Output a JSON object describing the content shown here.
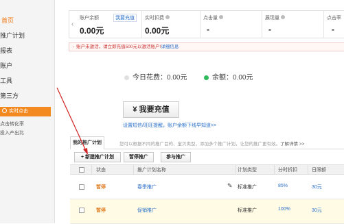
{
  "sidebar": {
    "items": [
      {
        "label": "首页",
        "active": true
      },
      {
        "label": "推广计划",
        "active": false
      },
      {
        "label": "报表",
        "active": false
      },
      {
        "label": "账户",
        "active": false
      },
      {
        "label": "工具",
        "active": false
      },
      {
        "label": "第三方",
        "active": false
      }
    ],
    "widget_title": "实时点击",
    "widget_lines": [
      "点击转化率",
      "投入产出比"
    ]
  },
  "cards": [
    {
      "label": "账户余额",
      "value": "0.00元",
      "link": "我要充值"
    },
    {
      "label": "实时扣费",
      "value": "0.00元"
    },
    {
      "label": "点击量",
      "value": "-"
    },
    {
      "label": "展现量",
      "value": "-"
    },
    {
      "label": "点击率",
      "value": "-"
    }
  ],
  "notice": {
    "text": "账户未激活，请立即充值500元以激活账户!",
    "link": "详细信息"
  },
  "spend": {
    "today_label": "今日花费：",
    "today_value": "0.00元",
    "balance_label": "余额：",
    "balance_value": "0.00元"
  },
  "recharge_button": "¥ 我要充值",
  "tip": "设置短信/旺旺提醒，账户余额下线早知道>>",
  "tab": {
    "label": "我的推广计划",
    "tip": "您可以根据不同的推广目的、宝贝类型，添加多个推广计划，让您的推广更有效。",
    "tip_link": "了解详情 >>"
  },
  "toolbar": {
    "new": "+ 新建推广计划",
    "pause": "暂停推广",
    "join": "参与推广"
  },
  "table": {
    "headers": [
      "状态",
      "推广计划名称",
      "计划类型",
      "分时折扣",
      "日限额"
    ],
    "rows": [
      {
        "status": "暂停",
        "name": "春季推广",
        "type": "标准推广",
        "discount": "85%",
        "limit": "30元"
      },
      {
        "status": "暂停",
        "name": "促销推广",
        "type": "标准推广",
        "discount": "100%",
        "limit": "30元"
      }
    ]
  },
  "colors": {
    "accent": "#f28a1f",
    "link": "#2a6fc9",
    "today_dot": "#e0e0e0",
    "balance_dot": "#2fb85c",
    "annotation": "#d22222"
  }
}
